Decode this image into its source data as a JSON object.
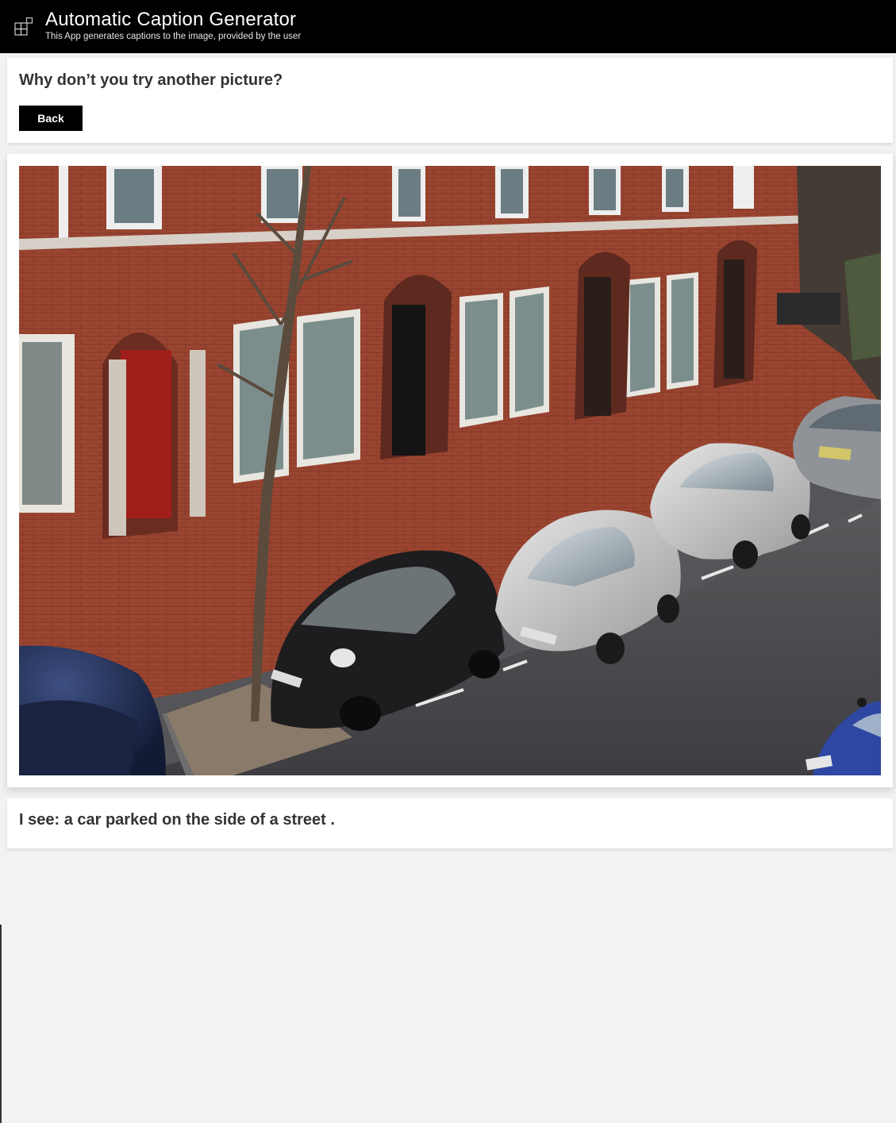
{
  "header": {
    "title": "Automatic Caption Generator",
    "subtitle": "This App generates captions to the image, provided by the user",
    "icon": "dashboard-icon"
  },
  "prompt": {
    "text": "Why don’t you try another picture?",
    "back_label": "Back"
  },
  "image": {
    "alt": "a car parked on the side of a street"
  },
  "result": {
    "caption": "I see: a car parked on the side of a street ."
  },
  "colors": {
    "header_bg": "#000000",
    "page_bg": "#f2f2f2",
    "card_bg": "#ffffff",
    "button_bg": "#000000"
  }
}
